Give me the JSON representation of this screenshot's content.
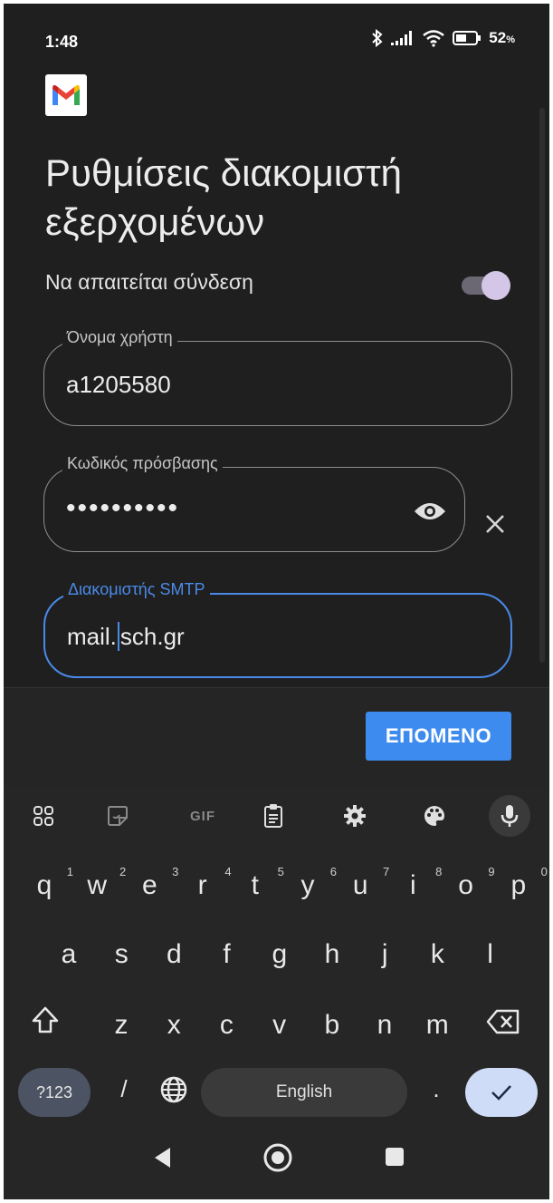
{
  "status_bar": {
    "time": "1:48",
    "battery_percent": "52",
    "battery_unit": "%",
    "icons": [
      "bluetooth-icon",
      "signal-icon",
      "wifi-icon",
      "battery-icon"
    ]
  },
  "app": {
    "logo": "gmail-logo-icon"
  },
  "screen": {
    "title": "Ρυθμίσεις διακομιστή εξερχομένων",
    "require_login_label": "Να απαιτείται σύνδεση",
    "require_login_on": true,
    "username": {
      "label": "Όνομα χρήστη",
      "value": "a1205580"
    },
    "password": {
      "label": "Κωδικός πρόσβασης",
      "value": "••••••••••"
    },
    "smtp": {
      "label": "Διακομιστής SMTP",
      "value_before_cursor": "mail.",
      "value_after_cursor": "sch.gr"
    },
    "next_button": "ΕΠΟΜΕΝΟ"
  },
  "keyboard": {
    "toolbar": [
      "apps-grid-icon",
      "sticker-icon",
      "gif-icon",
      "clipboard-icon",
      "settings-gear-icon",
      "palette-icon",
      "mic-icon"
    ],
    "gif_label": "GIF",
    "row1": [
      {
        "k": "q",
        "n": "1"
      },
      {
        "k": "w",
        "n": "2"
      },
      {
        "k": "e",
        "n": "3"
      },
      {
        "k": "r",
        "n": "4"
      },
      {
        "k": "t",
        "n": "5"
      },
      {
        "k": "y",
        "n": "6"
      },
      {
        "k": "u",
        "n": "7"
      },
      {
        "k": "i",
        "n": "8"
      },
      {
        "k": "o",
        "n": "9"
      },
      {
        "k": "p",
        "n": "0"
      }
    ],
    "row2": [
      "a",
      "s",
      "d",
      "f",
      "g",
      "h",
      "j",
      "k",
      "l"
    ],
    "row3": [
      "z",
      "x",
      "c",
      "v",
      "b",
      "n",
      "m"
    ],
    "symbols_key": "?123",
    "slash_key": "/",
    "space_key": "English",
    "period_key": ".",
    "accent": "#cfdcf7"
  },
  "colors": {
    "background": "#1f1f1f",
    "focus": "#4a8ae8",
    "primary_button": "#3d8bef",
    "toggle_thumb": "#d4c6e7"
  }
}
